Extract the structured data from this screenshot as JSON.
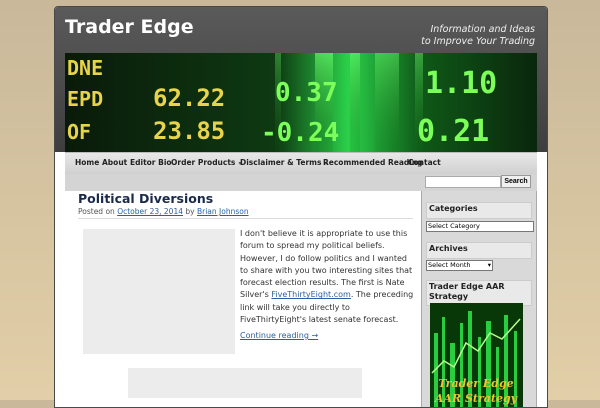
{
  "site": {
    "title": "Trader Edge",
    "tagline_line1": "Information and Ideas",
    "tagline_line2": "to Improve Your Trading"
  },
  "banner": {
    "icon": "ticker-board-image",
    "left_rows": [
      "DNE",
      "EPD",
      "OF"
    ],
    "mid_rows": [
      "62.22",
      "23.85"
    ],
    "right_rows": [
      "0.37",
      "-0.24"
    ],
    "far_right_rows": [
      "1.10",
      "0.21"
    ]
  },
  "nav": {
    "items": [
      {
        "label": "Home",
        "dropdown": false,
        "active": true
      },
      {
        "label": "About",
        "dropdown": false
      },
      {
        "label": "Editor Bio",
        "dropdown": false
      },
      {
        "label": "Order Products",
        "dropdown": true
      },
      {
        "label": "Disclaimer & Terms",
        "dropdown": true
      },
      {
        "label": "Recommended Reading",
        "dropdown": false
      },
      {
        "label": "Contact",
        "dropdown": false
      }
    ]
  },
  "search": {
    "button_label": "Search",
    "value": ""
  },
  "post": {
    "title": "Political Diversions",
    "posted_on": "Posted on",
    "date": "October 23, 2014",
    "by": "by",
    "author": "Brian Johnson",
    "body_before_link": "I don't believe it is appropriate to use this forum to spread my political beliefs. However, I do follow politics and I wanted to share with you two interesting sites that forecast election results. The first is Nate Silver's ",
    "link_text": "FiveThirtyEight.com",
    "body_after_link": ". The preceding link will take you directly to FiveThirtyEight's latest senate forecast.",
    "continue_label": "Continue reading →"
  },
  "sidebar": {
    "categories_title": "Categories",
    "categories_select": "Select Category",
    "archives_title": "Archives",
    "archives_select": "Select Month",
    "strategy_title": "Trader Edge AAR Strategy",
    "strategy_image_line1": "Trader Edge",
    "strategy_image_line2": "AAR Strategy"
  },
  "colors": {
    "header_bg": "#4a4a4a",
    "link": "#2b5f9f",
    "banner_green": "#39ff14",
    "ticker_yellow": "#e8d44a"
  }
}
